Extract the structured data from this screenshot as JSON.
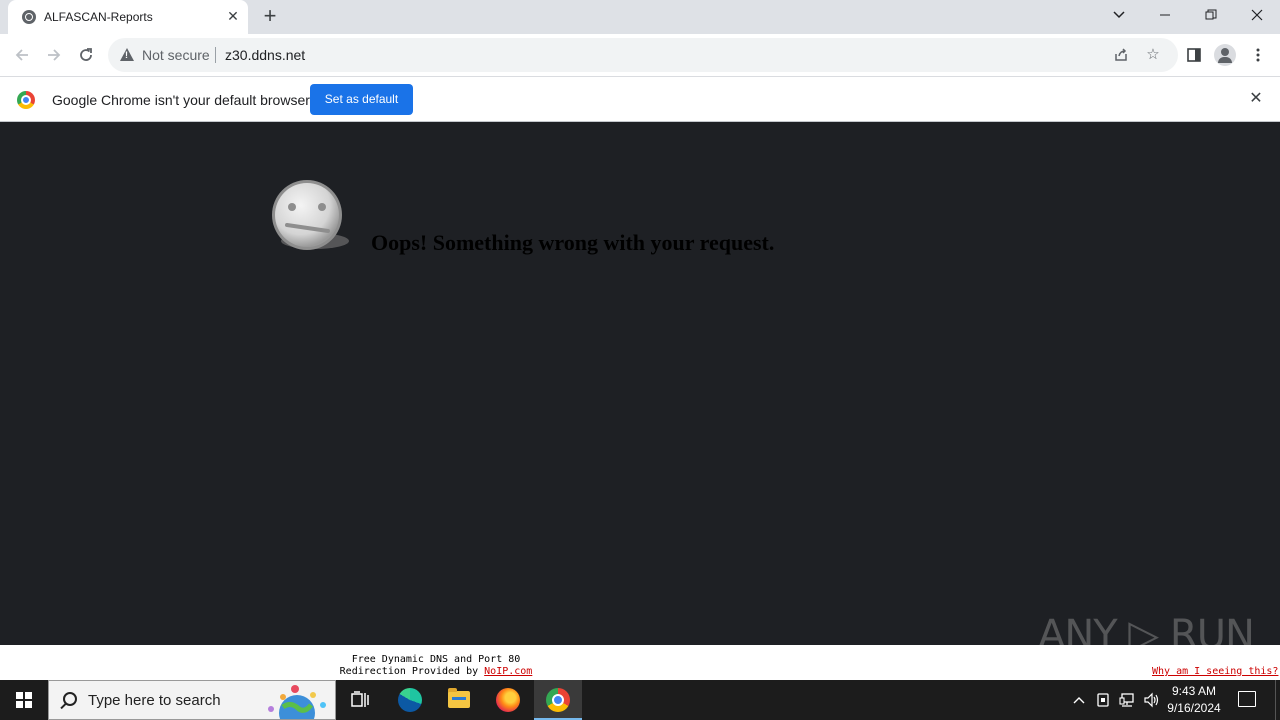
{
  "browser": {
    "tab": {
      "title": "ALFASCAN-Reports"
    },
    "address_bar": {
      "security_label": "Not secure",
      "url": "z30.ddns.net"
    },
    "infobar": {
      "message": "Google Chrome isn't your default browser",
      "button_label": "Set as default"
    },
    "window_controls": [
      "tab-search",
      "minimize",
      "restore",
      "close"
    ]
  },
  "page": {
    "error_message": "Oops! Something wrong with your request.",
    "background_color": "#1e2024",
    "footer": {
      "line1": "Free Dynamic DNS and Port 80",
      "line2_prefix": "Redirection Provided by ",
      "line2_link": "NoIP.com",
      "why_link": "Why am I seeing this?"
    },
    "watermark": "ANY RUN"
  },
  "taskbar": {
    "search_placeholder": "Type here to search",
    "apps": [
      "task-view",
      "edge",
      "file-explorer",
      "firefox",
      "chrome"
    ],
    "active_app": "chrome",
    "clock": {
      "time": "9:43 AM",
      "date": "9/16/2024"
    }
  },
  "colors": {
    "accent": "#1a73e8",
    "link": "#cc0000",
    "titlebar": "#dee1e6",
    "taskbar": "#1c1c1c"
  }
}
